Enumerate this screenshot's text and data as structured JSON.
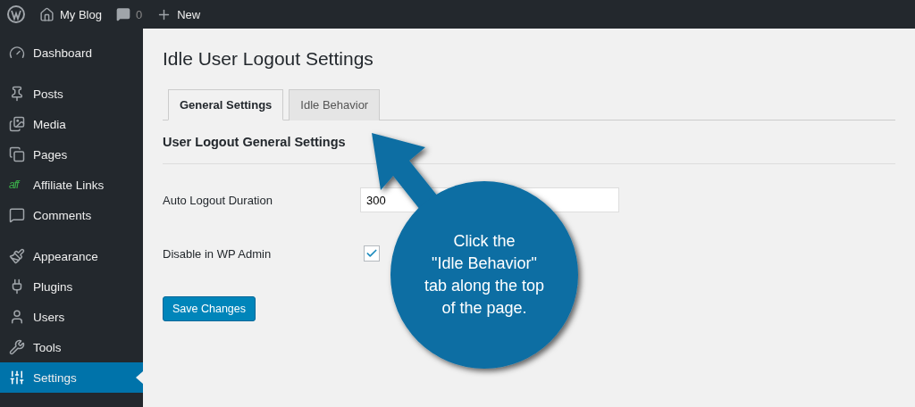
{
  "admin_bar": {
    "site_name": "My Blog",
    "comments_count": "0",
    "new_label": "New"
  },
  "sidebar": {
    "groups": [
      [
        {
          "label": "Dashboard",
          "selected": false
        }
      ],
      [
        {
          "label": "Posts",
          "selected": false
        },
        {
          "label": "Media",
          "selected": false
        },
        {
          "label": "Pages",
          "selected": false
        },
        {
          "label": "Affiliate Links",
          "icon_text": "aff",
          "selected": false
        },
        {
          "label": "Comments",
          "selected": false
        }
      ],
      [
        {
          "label": "Appearance",
          "selected": false
        },
        {
          "label": "Plugins",
          "selected": false
        },
        {
          "label": "Users",
          "selected": false
        },
        {
          "label": "Tools",
          "selected": false
        },
        {
          "label": "Settings",
          "selected": true
        }
      ]
    ]
  },
  "page_title": "Idle User Logout Settings",
  "tabs": [
    {
      "label": "General Settings",
      "selected": true
    },
    {
      "label": "Idle Behavior",
      "selected": false
    }
  ],
  "section_title": "User Logout General Settings",
  "fields": [
    {
      "kind": "text",
      "label": "Auto Logout Duration",
      "value": "300"
    },
    {
      "kind": "checkbox",
      "label": "Disable in WP Admin",
      "checked": true
    }
  ],
  "save_button": "Save Changes",
  "callout": {
    "lines": [
      "Click the",
      "\"Idle Behavior\"",
      "tab along the top",
      "of the page."
    ]
  }
}
